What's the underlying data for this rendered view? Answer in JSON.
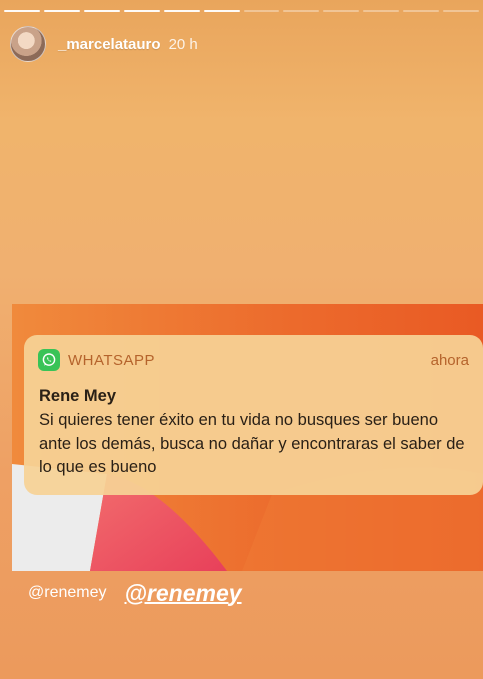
{
  "story": {
    "progress": {
      "segments": 12,
      "completed": 6
    },
    "header": {
      "username": "_marcelatauro",
      "time": "20 h"
    },
    "notification": {
      "app_name": "WHATSAPP",
      "time": "ahora",
      "sender": "Rene Mey",
      "message": "Si quieres tener éxito en tu vida no busques ser bueno ante los demás, busca no dañar y encontraras el saber de lo que es bueno",
      "app_color": "#39c357"
    },
    "mentions": {
      "plain": "@renemey",
      "bold": "@renemey"
    }
  }
}
